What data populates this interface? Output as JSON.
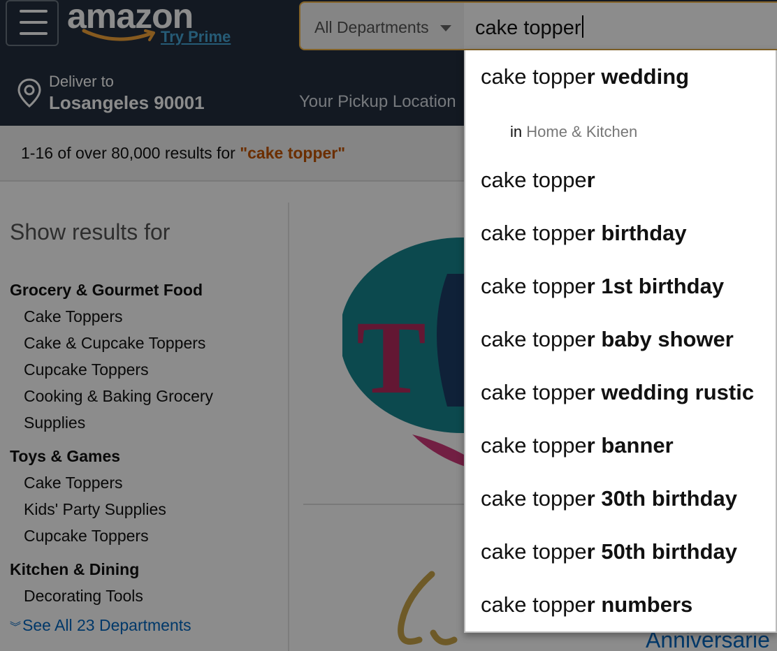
{
  "header": {
    "logo_text": "amazon",
    "try_prime": "Try Prime",
    "search": {
      "department": "All Departments",
      "query": "cake topper"
    },
    "deliver": {
      "label": "Deliver to",
      "location": "Losangeles 90001"
    },
    "pickup_text": "Your Pickup Location"
  },
  "results": {
    "prefix": "1-16 of over 80,000 results for ",
    "query": "\"cake topper\""
  },
  "sidebar": {
    "heading": "Show results for",
    "categories": [
      {
        "title": "Grocery & Gourmet Food",
        "items": [
          "Cake Toppers",
          "Cake & Cupcake Toppers",
          "Cupcake Toppers",
          "Cooking & Baking Grocery",
          "Supplies"
        ]
      },
      {
        "title": "Toys & Games",
        "items": [
          "Cake Toppers",
          "Kids' Party Supplies",
          "Cupcake Toppers"
        ]
      },
      {
        "title": "Kitchen & Dining",
        "items": [
          "Decorating Tools"
        ]
      }
    ],
    "see_all": "See All 23 Departments"
  },
  "product": {
    "second_title_partial": "Anniversarie"
  },
  "suggestions": {
    "prefix": "cake toppe",
    "items": [
      {
        "typed_tail": "r",
        "completion": " wedding"
      },
      {
        "scope_in": "in ",
        "scope_dept": "Home & Kitchen"
      },
      {
        "typed_tail": "r",
        "completion": ""
      },
      {
        "typed_tail": "r",
        "completion": " birthday"
      },
      {
        "typed_tail": "r",
        "completion": " 1st birthday"
      },
      {
        "typed_tail": "r",
        "completion": " baby shower"
      },
      {
        "typed_tail": "r",
        "completion": " wedding rustic"
      },
      {
        "typed_tail": "r",
        "completion": " banner"
      },
      {
        "typed_tail": "r",
        "completion": " 30th birthday"
      },
      {
        "typed_tail": "r",
        "completion": " 50th birthday"
      },
      {
        "typed_tail": "r",
        "completion": " numbers"
      }
    ]
  },
  "colors": {
    "header_bg": "#232f3e",
    "prime_blue": "#46a6d8",
    "search_border": "#f0b44a",
    "query_orange": "#c45500",
    "link_blue": "#0066c0"
  }
}
